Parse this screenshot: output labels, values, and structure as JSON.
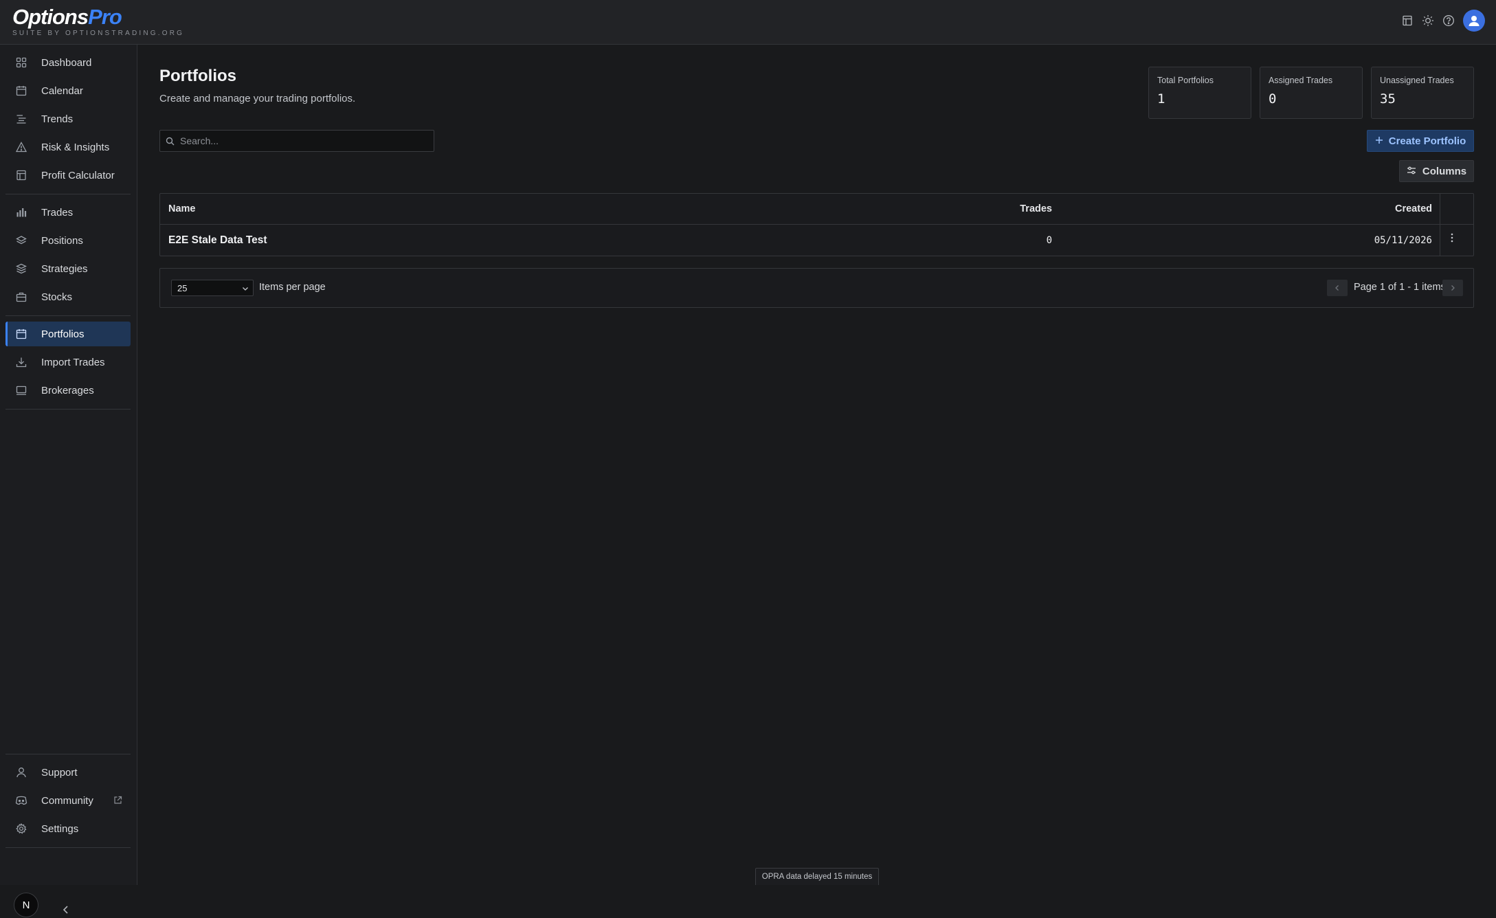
{
  "header": {
    "logo_main": "Options",
    "logo_accent": "Pro",
    "logo_sub": "SUITE BY OPTIONSTRADING.ORG",
    "icons": [
      "calculator-icon",
      "sun-icon",
      "help-icon",
      "avatar-icon"
    ]
  },
  "sidebar": {
    "group1": [
      {
        "label": "Dashboard",
        "icon": "grid-icon"
      },
      {
        "label": "Calendar",
        "icon": "calendar-icon"
      },
      {
        "label": "Trends",
        "icon": "list-icon"
      },
      {
        "label": "Risk & Insights",
        "icon": "warning-icon"
      },
      {
        "label": "Profit Calculator",
        "icon": "calculator-icon"
      }
    ],
    "group2": [
      {
        "label": "Trades",
        "icon": "bar-chart-icon"
      },
      {
        "label": "Positions",
        "icon": "layers-icon"
      },
      {
        "label": "Strategies",
        "icon": "stack-icon"
      },
      {
        "label": "Stocks",
        "icon": "briefcase-icon"
      }
    ],
    "group3": [
      {
        "label": "Portfolios",
        "icon": "portfolio-icon",
        "active": true
      },
      {
        "label": "Import Trades",
        "icon": "download-icon"
      },
      {
        "label": "Brokerages",
        "icon": "monitor-icon"
      }
    ],
    "footer": [
      {
        "label": "Support",
        "icon": "user-icon"
      },
      {
        "label": "Community",
        "icon": "discord-icon"
      },
      {
        "label": "Settings",
        "icon": "gear-icon"
      }
    ],
    "user_initial": "N"
  },
  "page": {
    "title": "Portfolios",
    "subtitle": "Create and manage your trading portfolios."
  },
  "stats": [
    {
      "label": "Total Portfolios",
      "value": "1"
    },
    {
      "label": "Assigned Trades",
      "value": "0"
    },
    {
      "label": "Unassigned Trades",
      "value": "35"
    }
  ],
  "search": {
    "placeholder": "Search..."
  },
  "actions": {
    "create_label": "Create Portfolio",
    "columns_label": "Columns"
  },
  "table": {
    "headers": {
      "name": "Name",
      "trades": "Trades",
      "created": "Created"
    },
    "rows": [
      {
        "name": "E2E Stale Data Test",
        "trades": "0",
        "created": "05/11/2026"
      }
    ]
  },
  "pagination": {
    "per_page": "25",
    "per_page_label": "Items per page",
    "info": "Page 1 of 1 - 1 items"
  },
  "footer_note": "OPRA data delayed 15 minutes",
  "colors": {
    "accent": "#3b82f6",
    "background": "#191a1c",
    "active_nav": "#1f3656"
  }
}
